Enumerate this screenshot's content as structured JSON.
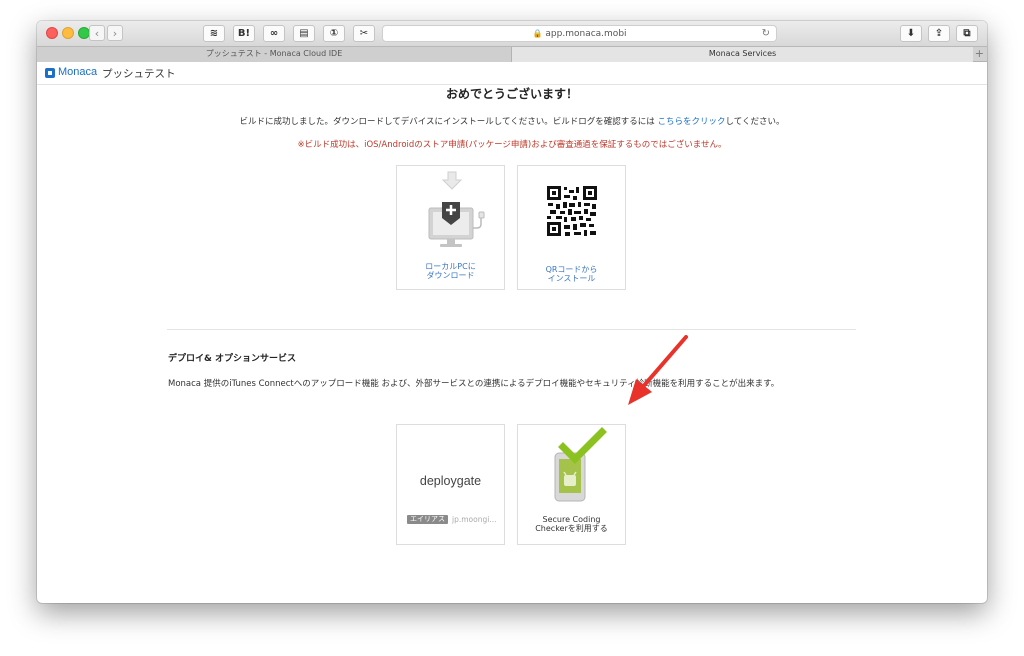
{
  "browser": {
    "nav_back": "‹",
    "nav_forward": "›",
    "toolbar_buttons": [
      "≋",
      "B!",
      "∞",
      "▤",
      "①",
      "✂"
    ],
    "url": "app.monaca.mobi",
    "tabs": [
      {
        "label": "プッシュテスト - Monaca Cloud IDE"
      },
      {
        "label": "Monaca Services"
      }
    ],
    "new_tab": "+"
  },
  "header": {
    "logo_text": "Monaca",
    "project_name": "プッシュテスト"
  },
  "build": {
    "title": "おめでとうございます！",
    "message_prefix": "ビルドに成功しました。ダウンロードしてデバイスにインストールしてください。ビルドログを確認するには",
    "message_link": "こちらをクリック",
    "message_suffix": "してください。",
    "warning": "※ビルド成功は、iOS/Androidのストア申請(パッケージ申請)および審査通過を保証するものではございません。",
    "download_label_line1": "ローカルPCに",
    "download_label_line2": "ダウンロード",
    "qr_label_line1": "QRコードから",
    "qr_label_line2": "インストール"
  },
  "deploy": {
    "title": "デプロイ& オプションサービス",
    "description": "Monaca 提供のiTunes Connectへのアップロード機能 および、外部サービスとの連携によるデプロイ機能やセキュリティ診断機能を利用することが出来ます。",
    "deploygate_logo": "deploygate",
    "alias_badge": "エイリアス",
    "alias_value": "jp.moongi...",
    "scc_label_line1": "Secure Coding",
    "scc_label_line2": "Checkerを利用する"
  },
  "colors": {
    "accent": "#1b6fc8",
    "warning": "#c0392b",
    "arrow": "#e8322a",
    "check_green": "#8cc21f"
  }
}
